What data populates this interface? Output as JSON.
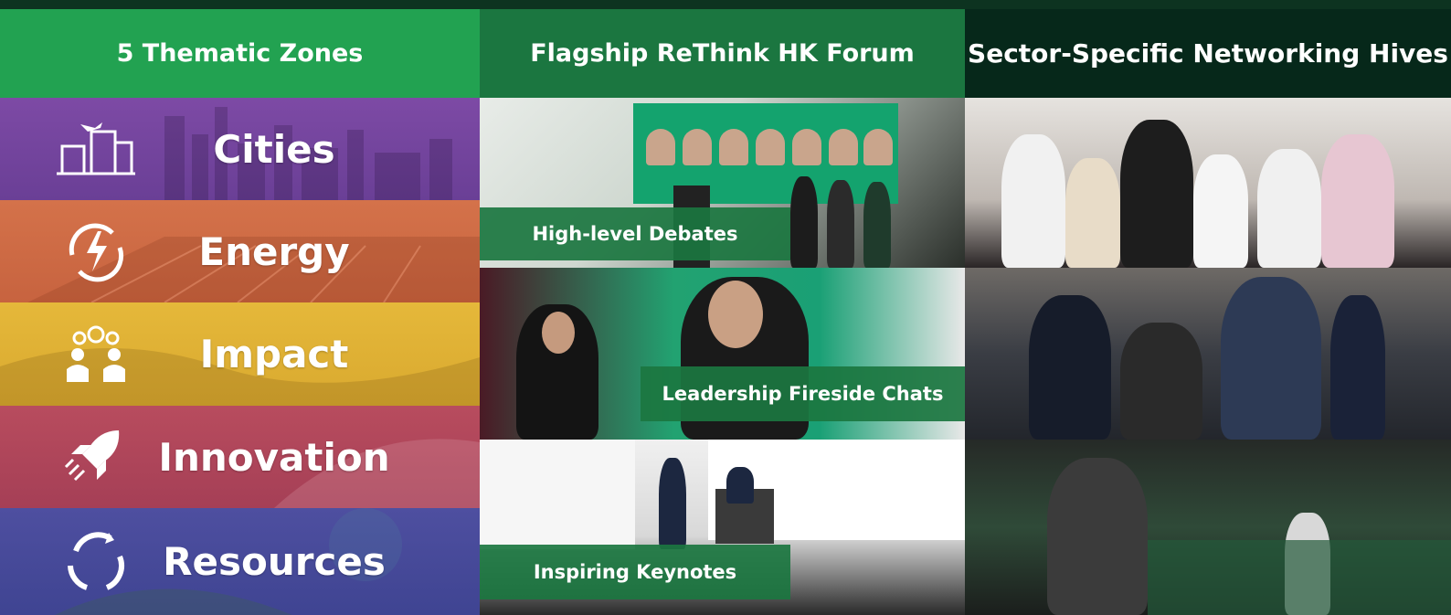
{
  "columns": {
    "zones": {
      "title": "5 Thematic Zones",
      "items": [
        {
          "label": "Cities",
          "icon": "city-icon",
          "color": "#6a3f96"
        },
        {
          "label": "Energy",
          "icon": "energy-icon",
          "color": "#c7633f"
        },
        {
          "label": "Impact",
          "icon": "impact-icon",
          "color": "#d9a92f"
        },
        {
          "label": "Innovation",
          "icon": "rocket-icon",
          "color": "#a53f56"
        },
        {
          "label": "Resources",
          "icon": "recycle-icon",
          "color": "#3f4492"
        }
      ]
    },
    "forum": {
      "title": "Flagship ReThink HK Forum",
      "panels": [
        {
          "caption": "High-level Debates"
        },
        {
          "caption": "Leadership Fireside Chats"
        },
        {
          "caption": "Inspiring Keynotes"
        }
      ]
    },
    "networking": {
      "title": "Sector-Specific Networking Hives"
    }
  },
  "colors": {
    "green_header": "#22a251",
    "dark_green_header": "#1b7640",
    "darkest_green_header": "#06281a"
  }
}
